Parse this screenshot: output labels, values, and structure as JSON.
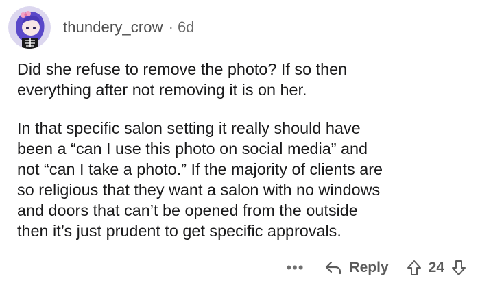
{
  "comment": {
    "username": "thundery_crow",
    "separator": "·",
    "age": "6d",
    "paragraphs": [
      "Did she refuse to remove the photo? If so then\neverything after not removing it is on her.",
      "In that specific salon setting it really should have\nbeen a “can I use this photo on social media” and\nnot “can I take a photo.” If the majority of clients are\nso religious that they want a salon with no windows\nand doors that can’t be opened from the outside\nthen it’s just prudent to get specific approvals."
    ]
  },
  "actions": {
    "more_label": "•••",
    "reply_label": "Reply",
    "score": "24",
    "icons": {
      "avatar": "avatar",
      "reply": "reply-arrow-icon",
      "upvote": "upvote-arrow-icon",
      "downvote": "downvote-arrow-icon"
    }
  },
  "colors": {
    "text": "#1a1a1b",
    "meta": "#6f6f6f",
    "avatar_bg": "#dcd7ef"
  }
}
